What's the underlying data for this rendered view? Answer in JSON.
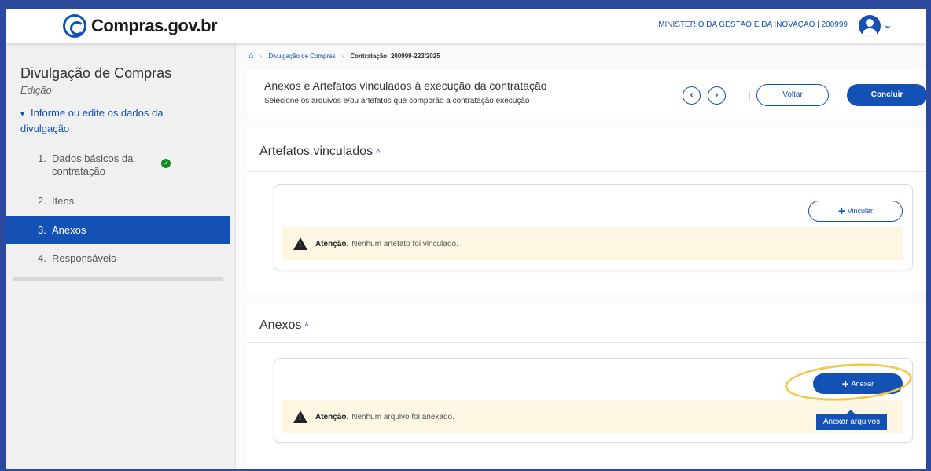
{
  "header": {
    "logo_text": "Compras.gov.br",
    "ministry": "MINISTÉRIO DA GESTÃO E DA INOVAÇÃO | 200999",
    "user_menu_chevron": "⌄"
  },
  "sidebar": {
    "title": "Divulgação de Compras",
    "subtitle": "Edição",
    "group_label": "Informe ou edite os dados da divulgação",
    "items": [
      {
        "number": "1.",
        "label": "Dados básicos da contratação",
        "completed": true
      },
      {
        "number": "2.",
        "label": "Itens",
        "completed": false
      },
      {
        "number": "3.",
        "label": "Anexos",
        "completed": false,
        "active": true
      },
      {
        "number": "4.",
        "label": "Responsáveis",
        "completed": false
      }
    ]
  },
  "breadcrumb": {
    "items": [
      "Divulgação de Compras",
      "Contratação: 200999-223/2025"
    ]
  },
  "page_header": {
    "title": "Anexos e Artefatos vinculados à execução da contratação",
    "description": "Selecione os arquivos e/ou artefatos que comporão a contratação execução",
    "back_label": "Voltar",
    "finish_label": "Concluir"
  },
  "artefatos": {
    "title": "Artefatos vinculados",
    "link_button": "Vincular",
    "alert_strong": "Atenção.",
    "alert_text": "Nenhum artefato foi vinculado."
  },
  "anexos": {
    "title": "Anexos",
    "attach_button": "Anexar",
    "tooltip": "Anexar arquivos",
    "alert_strong": "Atenção.",
    "alert_text": "Nenhum arquivo foi anexado."
  },
  "colors": {
    "primary": "#1351b4",
    "sidebar_active": "#1351b4",
    "alert_bg": "#fdf6e3",
    "success": "#168821",
    "highlight": "#f2c94c"
  }
}
